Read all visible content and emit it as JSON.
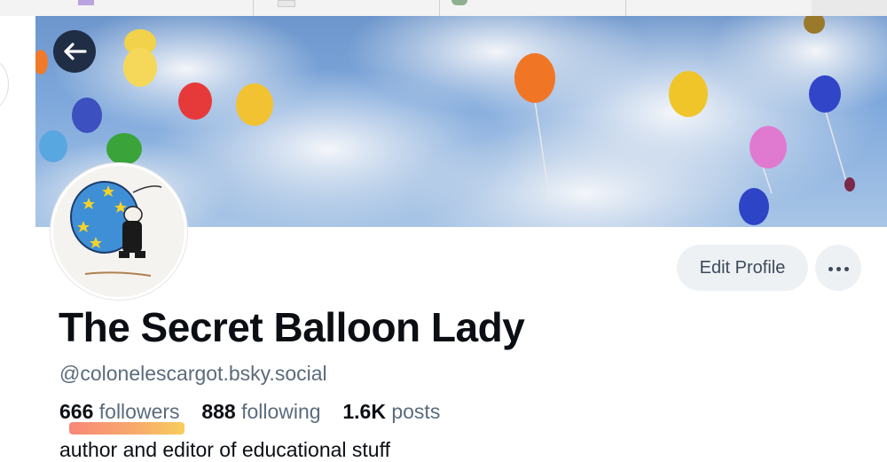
{
  "profile": {
    "display_name": "The Secret Balloon Lady",
    "handle": "@colonelescargot.bsky.social",
    "bio": "author and editor of educational stuff",
    "stats": {
      "followers_count": "666",
      "followers_label": "followers",
      "following_count": "888",
      "following_label": "following",
      "posts_count": "1.6K",
      "posts_label": "posts"
    }
  },
  "actions": {
    "edit_profile_label": "Edit Profile",
    "back_icon": "arrow-left-icon",
    "more_icon": "ellipsis-icon"
  },
  "colors": {
    "button_bg": "#eef1f4",
    "button_text": "#3c4a5b",
    "muted_text": "#5b6b7c",
    "back_button_bg": "#1f2d45",
    "followers_highlight": "#f7894f"
  }
}
